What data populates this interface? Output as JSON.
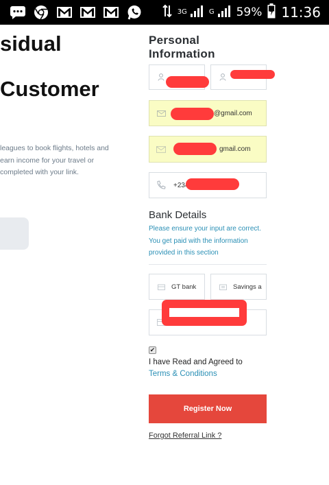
{
  "status_bar": {
    "network": "3G",
    "network2": "G",
    "battery": "59%",
    "time": "11:36"
  },
  "left_panel": {
    "title_line1": "sidual",
    "title_line2": "Customer",
    "desc_line1": "leagues to book flights, hotels and",
    "desc_line2": "earn income for your travel or",
    "desc_line3": "completed with your link."
  },
  "personal_info": {
    "title": "Personal Information",
    "email1_suffix": "@gmail.com",
    "email2_suffix": "gmail.com",
    "phone_prefix": "+234"
  },
  "bank_details": {
    "title": "Bank Details",
    "note": "Please ensure your input are correct. You get paid with the information provided in this section",
    "bank_name": "GT bank",
    "account_type": "Savings a"
  },
  "agreement": {
    "checked_mark": "✔",
    "text": "I have Read and Agreed to",
    "terms_link": "Terms & Conditions"
  },
  "actions": {
    "register_label": "Register Now",
    "forgot_label": "Forgot Referral Link ?"
  },
  "colors": {
    "accent_red": "#e5473c",
    "link_blue": "#2a8fb5",
    "autofill_yellow": "#fafcc4"
  }
}
